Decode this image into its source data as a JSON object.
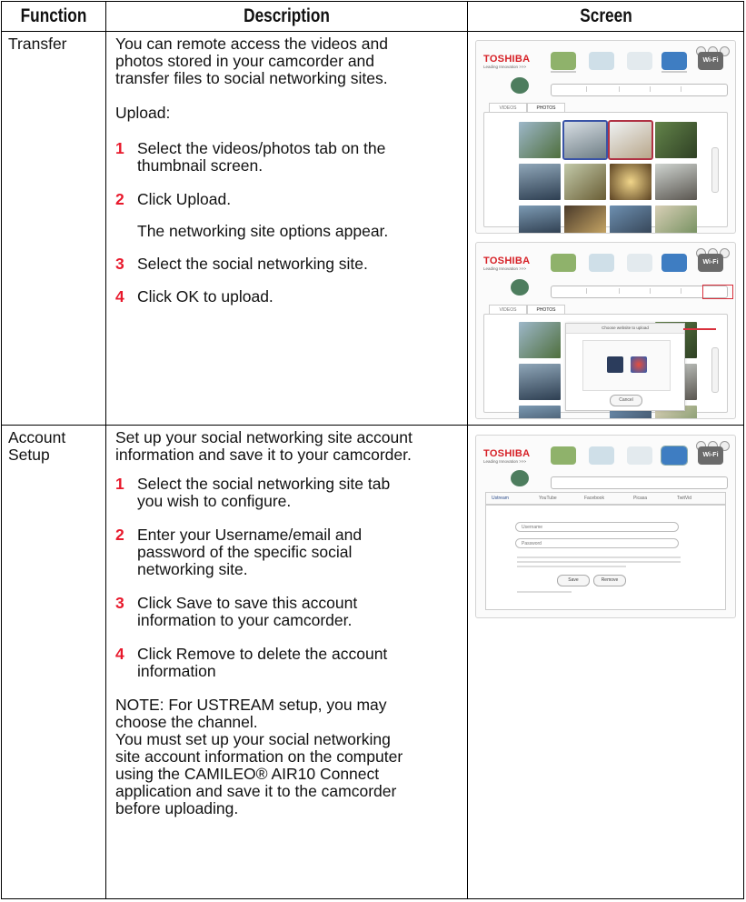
{
  "headers": {
    "function": "Function",
    "description": "Description",
    "screen": "Screen"
  },
  "transfer": {
    "function": "Transfer",
    "intro_lines": [
      "You can remote access the videos and",
      "photos stored in your camcorder and",
      "transfer files to social networking sites."
    ],
    "upload_label": "Upload:",
    "steps": [
      {
        "num": "1",
        "lines": [
          "Select the videos/photos tab on the",
          "thumbnail screen."
        ]
      },
      {
        "num": "2",
        "lines": [
          "Click Upload."
        ]
      },
      {
        "num": "",
        "lines": [
          "The networking site options appear."
        ]
      },
      {
        "num": "3",
        "lines": [
          "Select the social networking site."
        ]
      },
      {
        "num": "4",
        "lines": [
          "Click OK to upload."
        ]
      }
    ]
  },
  "account": {
    "function_lines": [
      "Account",
      "Setup"
    ],
    "intro_lines": [
      "Set up your social networking site account",
      "information and save it to your camcorder."
    ],
    "steps": [
      {
        "num": "1",
        "lines": [
          "Select the social networking site tab",
          "you wish to configure."
        ]
      },
      {
        "num": "2",
        "lines": [
          "Enter your Username/email and",
          "password of the specific social",
          "networking site."
        ]
      },
      {
        "num": "3",
        "lines": [
          "Click Save to save this account",
          "information to your camcorder."
        ]
      },
      {
        "num": "4",
        "lines": [
          "Click Remove to delete the account",
          "information"
        ]
      }
    ],
    "note_lines": [
      "NOTE: For USTREAM setup, you may",
      "choose the channel.",
      "You must set up your social networking",
      "site account information on the computer",
      "using the CAMILEO® AIR10 Connect",
      "application and save it to the camcorder",
      "before uploading."
    ]
  },
  "screens": {
    "brand": "TOSHIBA",
    "brand_tag": "Leading Innovation >>>",
    "wifi_badge": "Wi-Fi",
    "tab_videos": "VIDEOS",
    "tab_photos": "PHOTOS",
    "dialog_title": "Choose website to upload",
    "dialog_cancel": "Cancel",
    "account_tabs": [
      "Ustream",
      "YouTube",
      "Facebook",
      "Picasa",
      "TwitVid"
    ],
    "username_label": "Username",
    "password_label": "Password",
    "save_label": "Save",
    "remove_label": "Remove"
  },
  "colors": {
    "step_number": "#e8192c",
    "brand_red": "#d61f25"
  }
}
